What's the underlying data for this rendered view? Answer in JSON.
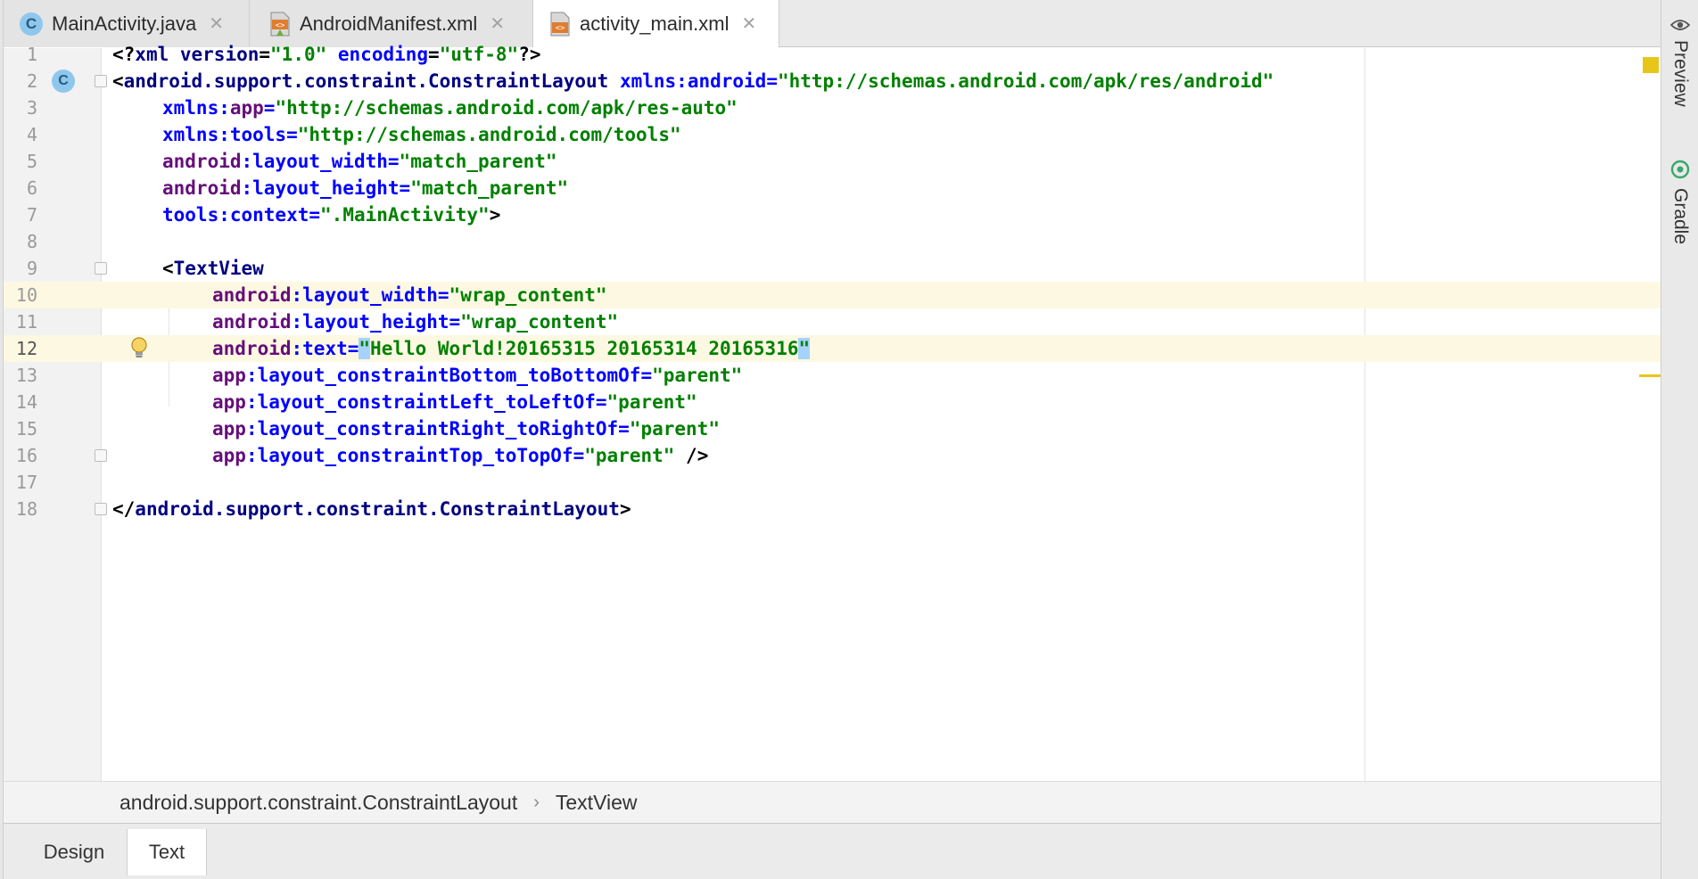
{
  "tabs": [
    {
      "label": "MainActivity.java",
      "icon": "java-class-icon"
    },
    {
      "label": "AndroidManifest.xml",
      "icon": "manifest-file-icon"
    },
    {
      "label": "activity_main.xml",
      "icon": "layout-xml-icon",
      "active": true
    }
  ],
  "close_glyph": "✕",
  "side_tools": {
    "preview": "Preview",
    "gradle": "Gradle"
  },
  "lines": {
    "n1": "1",
    "n2": "2",
    "n3": "3",
    "n4": "4",
    "n5": "5",
    "n6": "6",
    "n7": "7",
    "n8": "8",
    "n9": "9",
    "n10": "10",
    "n11": "11",
    "n12": "12",
    "n13": "13",
    "n14": "14",
    "n15": "15",
    "n16": "16",
    "n17": "17",
    "n18": "18"
  },
  "code": {
    "l1": {
      "a": "<?",
      "b": "xml version",
      "c": "=",
      "d": "\"1.0\"",
      "e": " encoding",
      "f": "=",
      "g": "\"utf-8\"",
      "h": "?>"
    },
    "l2": {
      "a": "<",
      "b": "android.support.constraint.ConstraintLayout ",
      "c": "xmlns:",
      "d": "android",
      "e": "=",
      "f": "\"http://schemas.android.com/apk/res/android\""
    },
    "l3": {
      "a": "xmlns:",
      "b": "app",
      "c": "=",
      "d": "\"http://schemas.android.com/apk/res-auto\""
    },
    "l4": {
      "a": "xmlns:",
      "b": "tools",
      "c": "=",
      "d": "\"http://schemas.android.com/tools\""
    },
    "l5": {
      "a": "android",
      "b": ":layout_width",
      "c": "=",
      "d": "\"match_parent\""
    },
    "l6": {
      "a": "android",
      "b": ":layout_height",
      "c": "=",
      "d": "\"match_parent\""
    },
    "l7": {
      "a": "tools",
      "b": ":context",
      "c": "=",
      "d": "\".MainActivity\"",
      "e": ">"
    },
    "l9": {
      "a": "<",
      "b": "TextView"
    },
    "l10": {
      "a": "android",
      "b": ":layout_width",
      "c": "=",
      "d": "\"wrap_content\""
    },
    "l11": {
      "a": "android",
      "b": ":layout_height",
      "c": "=",
      "d": "\"wrap_content\""
    },
    "l12": {
      "a": "android",
      "b": ":text",
      "c": "=",
      "q1": "\"",
      "d": "Hello World!20165315 20165314 20165316",
      "q2": "\""
    },
    "l13": {
      "a": "app",
      "b": ":layout_constraintBottom_toBottomOf",
      "c": "=",
      "d": "\"parent\""
    },
    "l14": {
      "a": "app",
      "b": ":layout_constraintLeft_toLeftOf",
      "c": "=",
      "d": "\"parent\""
    },
    "l15": {
      "a": "app",
      "b": ":layout_constraintRight_toRightOf",
      "c": "=",
      "d": "\"parent\""
    },
    "l16": {
      "a": "app",
      "b": ":layout_constraintTop_toTopOf",
      "c": "=",
      "d": "\"parent\"",
      "e": " />"
    },
    "l18": {
      "a": "</",
      "b": "android.support.constraint.ConstraintLayout",
      "c": ">"
    }
  },
  "gutter_marker": "C",
  "breadcrumb": {
    "item1": "android.support.constraint.ConstraintLayout",
    "sep": "›",
    "item2": "TextView"
  },
  "bottom_tabs": {
    "design": "Design",
    "text": "Text"
  },
  "colors": {
    "tag": "#000080",
    "attribute": "#0000ff",
    "namespace": "#660e7a",
    "value": "#008000",
    "current_line": "#fdf8e2",
    "selection": "#a6d2ff",
    "warning": "#e8c619"
  }
}
